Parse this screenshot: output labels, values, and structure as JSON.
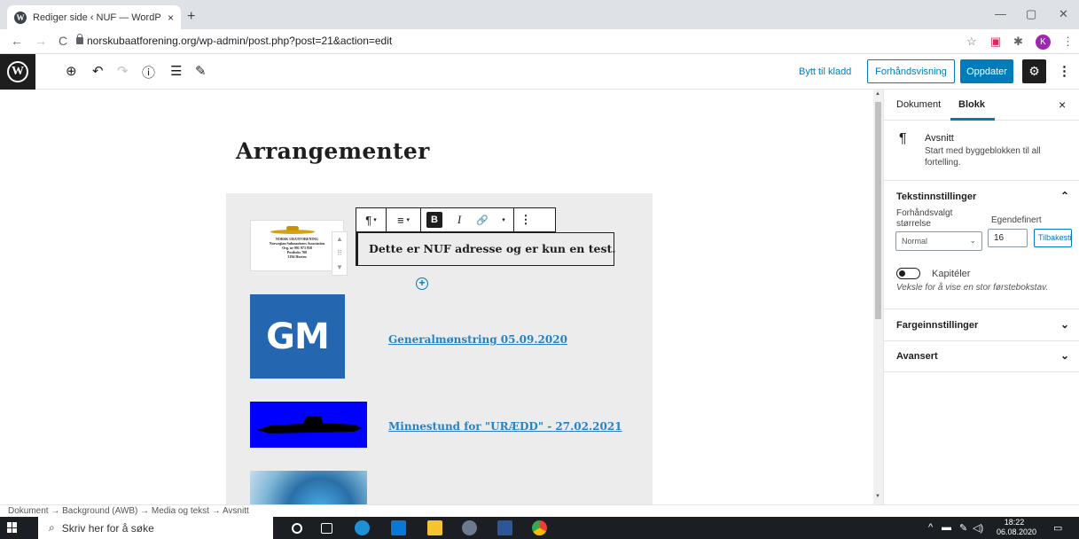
{
  "browser": {
    "tab_title": "Rediger side ‹ NUF — WordPress",
    "tab_close": "×",
    "new_tab": "+",
    "url": "norskubaatforening.org/wp-admin/post.php?post=21&action=edit",
    "avatar_letter": "K",
    "win_minimize": "—",
    "win_maximize": "▢",
    "win_close": "✕",
    "nav_back": "←",
    "nav_forward": "→",
    "nav_reload": "C",
    "ext_star": "☆",
    "ext_pocket": "▣",
    "ext_puzzle": "✱",
    "ext_menu": "⋮"
  },
  "editor_toolbar": {
    "logo": "W",
    "add": "⊕",
    "undo": "↶",
    "redo": "↷",
    "info": "ⓘ",
    "outline": "☰",
    "tools": "✎",
    "draft_link": "Bytt til kladd",
    "preview_button": "Forhåndsvisning",
    "update_button": "Oppdater",
    "settings": "⚙",
    "more": "⋮"
  },
  "canvas": {
    "title": "Arrangementer",
    "paragraph_text": "Dette er NUF adresse og er kun en test.",
    "block_toolbar": {
      "paragraph": "¶",
      "align": "≡",
      "bold": "B",
      "italic": "I",
      "link": "🔗",
      "more_caret": "▾",
      "options": "⋮"
    },
    "mover_up": "▲",
    "mover_drag": "⠿",
    "mover_down": "▼",
    "inserter": "+",
    "logo_image": {
      "line1": "NORSK UBÅTFORENING",
      "line2": "Norwegian Submariners Association",
      "line3": "Org. nr 991 973 958",
      "line4": "Postboks 700",
      "line5": "3194 Horten"
    },
    "gm_text": "GM",
    "links": [
      {
        "label": "Generalmønstring 05.09.2020"
      },
      {
        "label": "Minnestund for \"URÆDD\" - 27.02.2021"
      }
    ]
  },
  "sidebar": {
    "tab_document": "Dokument",
    "tab_block": "Blokk",
    "close": "×",
    "block_icon": "¶",
    "block_name": "Avsnitt",
    "block_desc": "Start med byggeblokken til all fortelling.",
    "text_settings": {
      "heading": "Tekstinnstillinger",
      "chevron": "⌃",
      "preset_label": "Forhåndsvalgt størrelse",
      "custom_label": "Egendefinert",
      "preset_value": "Normal",
      "custom_value": "16",
      "reset_button": "Tilbakestill",
      "dropcap_label": "Kapitéler",
      "dropcap_help": "Veksle for å vise en stor førstebokstav."
    },
    "color_settings": {
      "heading": "Fargeinnstillinger",
      "chevron": "⌄"
    },
    "advanced": {
      "heading": "Avansert",
      "chevron": "⌄"
    }
  },
  "breadcrumb": "Dokument → Background (AWB) → Media og tekst → Avsnitt",
  "taskbar": {
    "search_placeholder": "Skriv her for å søke",
    "time": "18:22",
    "date": "06.08.2020"
  },
  "colors": {
    "wp_blue": "#007cba",
    "link_blue": "#2583c4",
    "gm_blue": "#2467b0",
    "submarine_blue": "#0000ff",
    "dark": "#1e1e1e"
  }
}
